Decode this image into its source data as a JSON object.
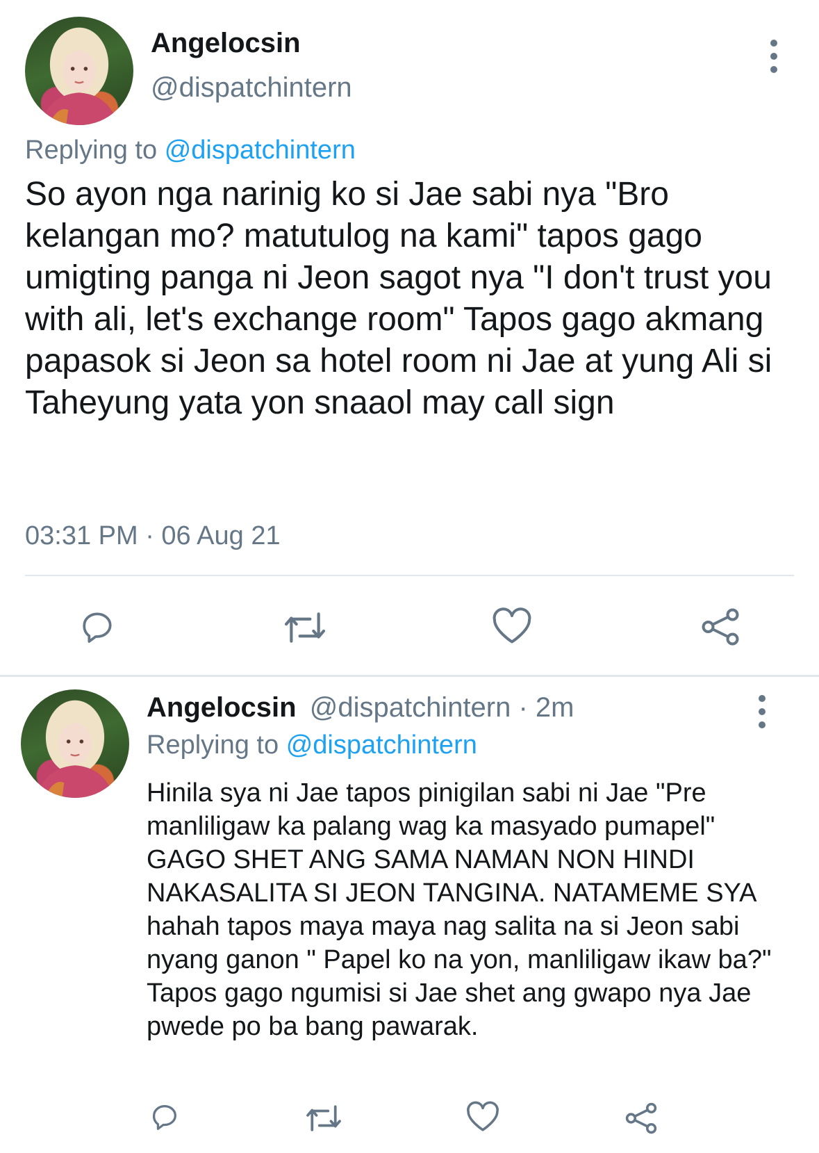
{
  "main_tweet": {
    "display_name": "Angelocsin",
    "handle": "@dispatchintern",
    "replying_prefix": "Replying to",
    "replying_to": "@dispatchintern",
    "text": "So ayon nga narinig ko si Jae sabi nya \"Bro kelangan mo? matutulog na kami\" tapos gago umigting panga ni Jeon sagot nya \"I don't trust you with ali, let's exchange room\" Tapos gago akmang papasok si Jeon sa hotel room ni Jae at yung Ali si Taheyung yata yon snaaol may call sign",
    "timestamp": "03:31 PM · 06 Aug 21",
    "actions": [
      "reply-icon",
      "retweet-icon",
      "like-icon",
      "share-icon"
    ]
  },
  "reply_tweet": {
    "display_name": "Angelocsin",
    "handle": "@dispatchintern",
    "time_ago": "· 2m",
    "replying_prefix": "Replying to",
    "replying_to": "@dispatchintern",
    "text": "Hinila sya ni Jae tapos pinigilan sabi ni Jae \"Pre manliligaw ka palang wag ka masyado pumapel\" GAGO SHET ANG SAMA NAMAN NON HINDI NAKASALITA SI JEON TANGINA. NATAMEME SYA hahah tapos maya maya nag salita na si Jeon sabi nyang ganon \" Papel ko na yon, manliligaw ikaw ba?\" Tapos gago ngumisi si Jae shet ang gwapo nya Jae pwede po ba bang pawarak.",
    "actions": [
      "reply-icon",
      "retweet-icon",
      "like-icon",
      "share-icon"
    ]
  },
  "colors": {
    "text": "#14171a",
    "secondary": "#657786",
    "link": "#1da1f2",
    "divider": "#e1e8ed"
  }
}
